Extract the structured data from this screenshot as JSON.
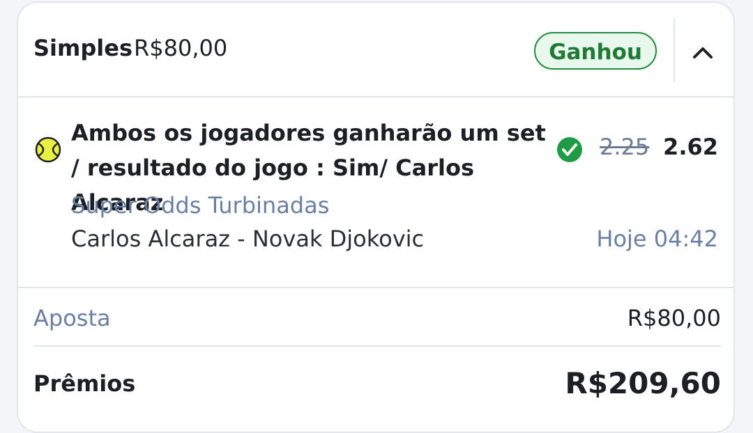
{
  "bet": {
    "type_label": "Simples",
    "stake_header": "R$80,00",
    "status_label": "Ganhou",
    "status_color": "#1f8a3c",
    "collapse_icon": "chevron-up-icon"
  },
  "selection": {
    "sport_icon": "tennis-ball-icon",
    "market": "Ambos os jogadores ganharão um set / resultado do jogo : Sim/ Carlos Alcaraz",
    "result_icon": "check-circle-icon",
    "old_odds": "2.25",
    "new_odds": "2.62",
    "promo": "Super Odds Turbinadas",
    "event": "Carlos Alcaraz - Novak Djokovic",
    "event_time": "Hoje 04:42"
  },
  "summary": {
    "stake_label": "Aposta",
    "stake_value": "R$80,00",
    "prize_label": "Prêmios",
    "prize_value": "R$209,60"
  }
}
